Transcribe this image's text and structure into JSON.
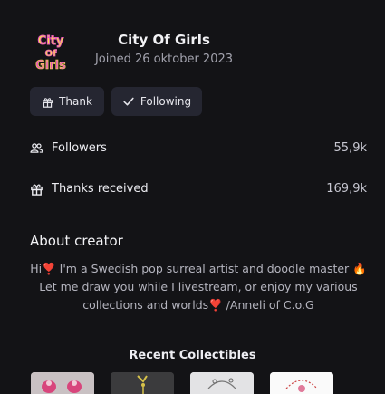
{
  "profile": {
    "name": "City Of Girls",
    "joined": "Joined 26 oktober 2023",
    "avatar_text": "City Of Girls"
  },
  "actions": {
    "thank_label": "Thank",
    "following_label": "Following"
  },
  "stats": {
    "followers_label": "Followers",
    "followers_value": "55,9k",
    "thanks_label": "Thanks received",
    "thanks_value": "169,9k"
  },
  "about": {
    "title": "About creator",
    "text": "Hi❣️ I'm a Swedish pop surreal artist and doodle master 🔥 Let me draw you while I livestream, or enjoy my various collections and worlds❣️ /Anneli of C.o.G"
  },
  "recent": {
    "title": "Recent Collectibles"
  },
  "colors": {
    "background": "#131316",
    "button": "#252631",
    "avatar_text": "#F7E04A",
    "avatar_accent": "#E85AB8"
  },
  "icons": {
    "thank": "gift-icon",
    "following": "check-icon",
    "followers": "users-icon",
    "thanks": "gift-icon"
  }
}
